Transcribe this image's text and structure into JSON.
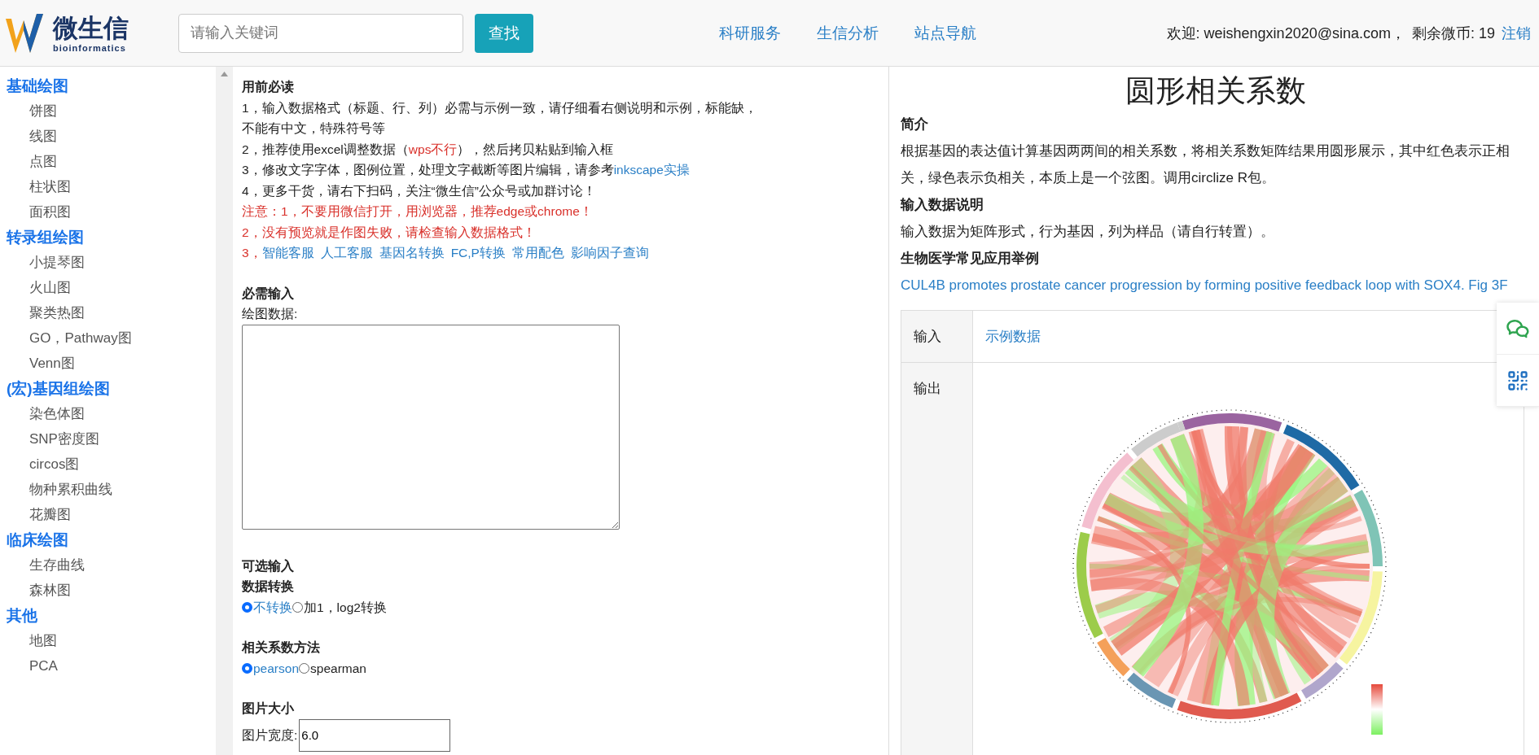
{
  "header": {
    "logo": {
      "title": "微生信",
      "subtitle": "bioinformatics"
    },
    "search": {
      "placeholder": "请输入关键词"
    },
    "search_button": "查找",
    "nav": [
      "科研服务",
      "生信分析",
      "站点导航"
    ],
    "user": {
      "welcome": "欢迎: weishengxin2020@sina.com，",
      "coins": "剩余微币: 19",
      "logout": "注销"
    }
  },
  "sidebar": [
    {
      "title": "基础绘图",
      "items": [
        "饼图",
        "线图",
        "点图",
        "柱状图",
        "面积图"
      ]
    },
    {
      "title": "转录组绘图",
      "items": [
        "小提琴图",
        "火山图",
        "聚类热图",
        "GO，Pathway图",
        "Venn图"
      ]
    },
    {
      "title": "(宏)基因组绘图",
      "items": [
        "染色体图",
        "SNP密度图",
        "circos图",
        "物种累积曲线",
        "花瓣图"
      ]
    },
    {
      "title": "临床绘图",
      "items": [
        "生存曲线",
        "森林图"
      ]
    },
    {
      "title": "其他",
      "items": [
        "地图",
        "PCA"
      ]
    }
  ],
  "notice": {
    "title": "用前必读",
    "lines": [
      [
        {
          "kind": "text",
          "text": "1，输入数据格式（标题、行、列）必需与示例一致，请仔细看右侧说明和示例，标能缺，"
        }
      ],
      [
        {
          "kind": "text",
          "text": "不能有中文，特殊符号等"
        }
      ],
      [
        {
          "kind": "text",
          "text": "2，推荐使用excel调整数据（"
        },
        {
          "kind": "warn",
          "text": "wps不行"
        },
        {
          "kind": "text",
          "text": "），然后拷贝粘贴到输入框"
        }
      ],
      [
        {
          "kind": "text",
          "text": "3，修改文字字体，图例位置，处理文字截断等图片编辑，请参考"
        },
        {
          "kind": "link",
          "text": "inkscape实操"
        }
      ],
      [
        {
          "kind": "text",
          "text": "4，更多干货，请右下扫码，关注“微生信”公众号或加群讨论！"
        }
      ],
      [
        {
          "kind": "warn",
          "text": "注意：1，不要用微信打开，用浏览器，推荐edge或chrome！"
        }
      ],
      [
        {
          "kind": "warn",
          "text": "2，没有预览就是作图失败，请检查输入数据格式！"
        }
      ],
      [
        {
          "kind": "warn",
          "text": "3，"
        },
        {
          "kind": "link",
          "text": "智能客服"
        },
        {
          "kind": "link",
          "text": "人工客服"
        },
        {
          "kind": "link",
          "text": "基因名转换"
        },
        {
          "kind": "link",
          "text": "FC,P转换"
        },
        {
          "kind": "link",
          "text": "常用配色"
        },
        {
          "kind": "link",
          "text": "影响因子查询"
        }
      ]
    ]
  },
  "required": {
    "title": "必需输入",
    "field_label": "绘图数据:"
  },
  "optional": {
    "title": "可选输入",
    "groups": [
      {
        "title": "数据转换",
        "options": [
          {
            "label": "不转换",
            "selected": true
          },
          {
            "label": "加1，log2转换",
            "selected": false
          }
        ]
      },
      {
        "title": "相关系数方法",
        "options": [
          {
            "label": "pearson",
            "selected": true
          },
          {
            "label": "spearman",
            "selected": false
          }
        ]
      }
    ]
  },
  "size": {
    "title": "图片大小",
    "field_label": "图片宽度:",
    "value": "6.0"
  },
  "info": {
    "title": "圆形相关系数",
    "sections": [
      {
        "heading": "简介",
        "kind": "text",
        "text": "根据基因的表达值计算基因两两间的相关系数，将相关系数矩阵结果用圆形展示，其中红色表示正相关，绿色表示负相关，本质上是一个弦图。调用circlize R包。"
      },
      {
        "heading": "输入数据说明",
        "kind": "text",
        "text": "输入数据为矩阵形式，行为基因，列为样品（请自行转置）。"
      },
      {
        "heading": "生物医学常见应用举例",
        "kind": "link",
        "text": "CUL4B promotes prostate cancer progression by forming positive feedback loop with SOX4. Fig 3F"
      }
    ],
    "table": [
      {
        "label": "输入",
        "link": "示例数据"
      },
      {
        "label": "输出"
      }
    ]
  }
}
